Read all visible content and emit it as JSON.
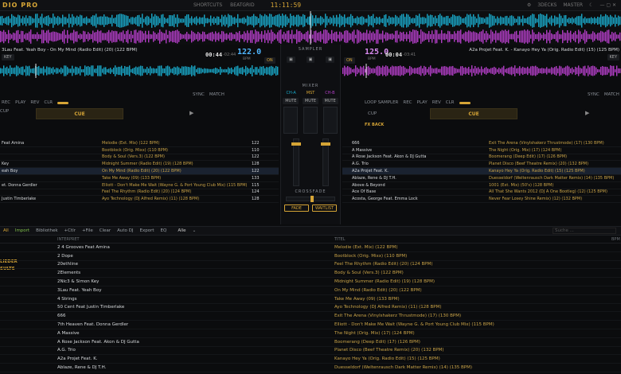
{
  "app": {
    "logo": "DIO PRO",
    "clock": "11:11:59"
  },
  "topbar": {
    "left_items": [
      "SHORTCUTS",
      "BEATGRID"
    ],
    "right_items": [
      "3DECKS",
      "MASTER"
    ]
  },
  "deck_a": {
    "title": "3Lau Feat. Yeah Boy - On My Mind (Radio Edit) (20) (122 BPM)",
    "key_badge": "KEY",
    "time": "00:44",
    "time_remain": "-02:44",
    "bpm": "122.0",
    "bpm_label": "BPM",
    "sync": "SYNC",
    "match": "MATCH",
    "sampler_buttons": [
      "REC",
      "PLAY",
      "REV",
      "CLR"
    ],
    "cup": "CUP",
    "cue": "CUE",
    "colors": {
      "wave": "#19a7c7"
    }
  },
  "deck_b": {
    "title": "A2a Projet Feat. K. - Kanayo Hey Ya (Orig. Radio Edit) (15) (125 BPM)",
    "key_badge": "KEY",
    "time": "00:04",
    "time_remain": "-03:41",
    "bpm": "125.0",
    "bpm_label": "BPM",
    "sync": "SYNC",
    "match": "MATCH",
    "loop_sampler": "LOOP SAMPLER",
    "sampler_buttons": [
      "REC",
      "PLAY",
      "REV",
      "CLR"
    ],
    "cup": "CUP",
    "cue": "CUE",
    "fx_back": "FX BACK",
    "colors": {
      "wave": "#b23ec6"
    }
  },
  "mixer": {
    "sampler": "SAMPLER",
    "mixer": "MIXER",
    "channels": [
      "CH-A",
      "MST",
      "CH-B"
    ],
    "mute": "MUTE",
    "crossfade": "CROSSFADE",
    "fade": "FADE",
    "waitlist": "WAITLIST",
    "on": "ON"
  },
  "left_list": {
    "rows": [
      {
        "artist": "Feat Amina",
        "title": "Melodie (Ext. Mix) (122 BPM)",
        "bpm": "122"
      },
      {
        "artist": "",
        "title": "Bootblock (Orig. Mixx) (110 BPM)",
        "bpm": "110"
      },
      {
        "artist": "",
        "title": "Body & Soul (Vers.3) (122 BPM)",
        "bpm": "122"
      },
      {
        "artist": "Key",
        "title": "Midnight Summer (Radio Edit) (19) (128 BPM)",
        "bpm": "128"
      },
      {
        "artist": "eah Boy",
        "title": "On My Mind (Radio Edit) (20) (122 BPM)",
        "bpm": "122"
      },
      {
        "artist": "",
        "title": "Take Me Away (09) (133 BPM)",
        "bpm": "133"
      },
      {
        "artist": "et. Donna Gerdler",
        "title": "Elliott - Don't Make Me Wait (Wayne G. & Port Young Club Mix) (115 BPM)",
        "bpm": "115"
      },
      {
        "artist": "",
        "title": "Feel The Rhythm (Radio Edit) (20) (124 BPM)",
        "bpm": "124"
      },
      {
        "artist": "Justin Timberlake",
        "title": "Ayo Technology (DJ Alfred Remix) (11) (128 BPM)",
        "bpm": "128"
      }
    ]
  },
  "right_list": {
    "rows": [
      {
        "artist": "666",
        "title": "Exit The Arena (Vinylshakerz Thrustmode) (17) (130 BPM)"
      },
      {
        "artist": "A Massive",
        "title": "The Night (Orig. Mix) (17) (124 BPM)"
      },
      {
        "artist": "A Rose Jackson Feat. Akon & DJ Gutta",
        "title": "Boomerang (Deep Edit) (17) (126 BPM)"
      },
      {
        "artist": "A.G. Trio",
        "title": "Planet Disco (Beef Theatre Remix) (20) (132 BPM)"
      },
      {
        "artist": "A2a Projet Feat. K.",
        "title": "Kanayo Hey Ya (Orig. Radio Edit) (15) (125 BPM)"
      },
      {
        "artist": "Ablaze, Rene & DJ T.H.",
        "title": "Duesseldorf (Weltenrausch Dark Matter Remix) (14) (135 BPM)"
      },
      {
        "artist": "Above & Beyond",
        "title": "1001 (Ext. Mix) (50's) (128 BPM)"
      },
      {
        "artist": "Ace Of Base",
        "title": "All That She Wants 2012 (DJ A One Bootleg) (12) (125 BPM)"
      },
      {
        "artist": "Acosta, George Feat. Emma Lock",
        "title": "Never Fear Losey Shine Remix) (12) (132 BPM)"
      }
    ]
  },
  "toolbar": {
    "items": [
      "All",
      "Import",
      "Bibliothek",
      "+Ctlr",
      "+File",
      "Clear",
      "Auto DJ",
      "Export",
      "EQ"
    ],
    "filter": "Alle",
    "search": "Suche ..."
  },
  "library": {
    "headers": [
      "INTERPRET",
      "TITEL",
      "BPM"
    ],
    "side_items": [
      "LIEDER",
      "SULTS"
    ],
    "rows": [
      {
        "artist": "2 4 Grooves Feat Amina",
        "title": "Melodie (Ext. Mix) (122 BPM)"
      },
      {
        "artist": "2 Dope",
        "title": "Bootblock (Orig. Mixx) (110 BPM)"
      },
      {
        "artist": "20ethline",
        "title": "Feel The Rhythm (Radio Edit) (20) (124 BPM)"
      },
      {
        "artist": "2Elements",
        "title": "Body & Soul (Vers.3) (122 BPM)"
      },
      {
        "artist": "2Nic3 & Simon Key",
        "title": "Midnight Summer (Radio Edit) (19) (128 BPM)"
      },
      {
        "artist": "3Lau Feat. Yeah Boy",
        "title": "On My Mind (Radio Edit) (20) (122 BPM)"
      },
      {
        "artist": "4 Strings",
        "title": "Take Me Away (09) (133 BPM)"
      },
      {
        "artist": "50 Cent Feat Justin Timberlake",
        "title": "Ayo Technology (DJ Alfred Remix) (11) (128 BPM)"
      },
      {
        "artist": "666",
        "title": "Exit The Arena (Vinylshakerz Thrustmode) (17) (130 BPM)"
      },
      {
        "artist": "7th Heaven Feat. Donna Gerdler",
        "title": "Elliott - Don't Make Me Wait (Wayne G. & Port Young Club Mix) (115 BPM)"
      },
      {
        "artist": "A Massive",
        "title": "The Night (Orig. Mix) (17) (124 BPM)"
      },
      {
        "artist": "A Rose Jackson Feat. Akon & DJ Gutta",
        "title": "Boomerang (Deep Edit) (17) (126 BPM)"
      },
      {
        "artist": "A.G. Trio",
        "title": "Planet Disco (Beef Theatre Remix) (20) (132 BPM)"
      },
      {
        "artist": "A2a Projet Feat. K.",
        "title": "Kanayo Hey Ya (Orig. Radio Edit) (15) (125 BPM)"
      },
      {
        "artist": "Ablaze, Rene & DJ T.H.",
        "title": "Duesseldorf (Weltenrausch Dark Matter Remix) (14) (135 BPM)"
      }
    ]
  }
}
